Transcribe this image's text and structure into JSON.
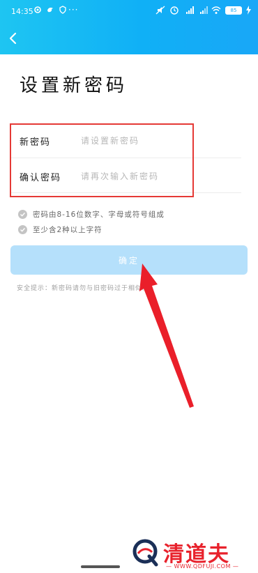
{
  "status_bar": {
    "time": "14:35",
    "more": "···",
    "battery": "85"
  },
  "header": {
    "back_icon": "chevron-left-icon"
  },
  "page": {
    "title": "设置新密码"
  },
  "form": {
    "new_password": {
      "label": "新密码",
      "placeholder": "请设置新密码",
      "value": ""
    },
    "confirm_password": {
      "label": "确认密码",
      "placeholder": "请再次输入新密码",
      "value": ""
    }
  },
  "rules": [
    {
      "text": "密码由8-16位数字、字母或符号组成",
      "icon": "check-circle-icon"
    },
    {
      "text": "至少含2种以上字符",
      "icon": "check-circle-icon"
    }
  ],
  "confirm_button": {
    "label": "确定"
  },
  "tip": "安全提示：新密码请勿与旧密码过于相似。",
  "watermark": {
    "brand": "清道夫",
    "url": "— WWW.QDFUJI.COM —"
  },
  "colors": {
    "header_gradient_start": "#1ec5f2",
    "header_gradient_end": "#19a7f7",
    "button_disabled": "#b5e0fb",
    "highlight_box": "#e53935",
    "annotation_arrow": "#e8222c"
  }
}
